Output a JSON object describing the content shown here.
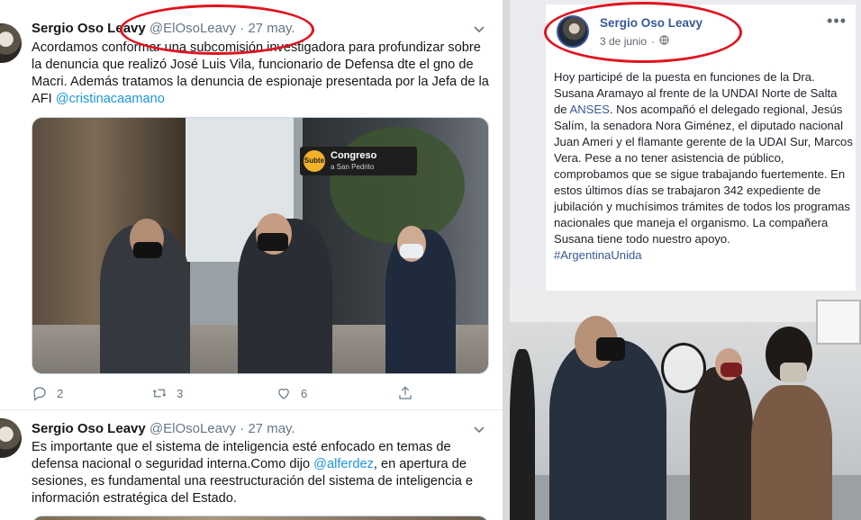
{
  "twitter": {
    "tweets": [
      {
        "name": "Sergio Oso Leavy",
        "handle": "@ElOsoLeavy",
        "dot": "·",
        "date": "27 may.",
        "text_before": "Acordamos conformar una subcomisión investigadora para profundizar sobre la denuncia  que realizó José Luis Vila, funcionario de Defensa dte el gno de Macri. Además tratamos la denuncia de espionaje presentada por la Jefa de la AFI ",
        "mention": "@cristinacaamano",
        "text_after": "",
        "photo": {
          "sign_title": "Congreso",
          "sign_sub": "a San Pedrito",
          "subte": "Subte"
        },
        "replies": "2",
        "retweets": "3",
        "likes": "6"
      },
      {
        "name": "Sergio Oso Leavy",
        "handle": "@ElOsoLeavy",
        "dot": "·",
        "date": "27 may.",
        "text_before": "Es importante que el sistema de inteligencia esté enfocado en temas de defensa nacional o seguridad interna.Como dijo ",
        "mention": "@alferdez",
        "text_after": ", en apertura de sesiones, es fundamental una  reestructuración del sistema de inteligencia e información estratégica del Estado."
      }
    ]
  },
  "facebook": {
    "name": "Sergio Oso Leavy",
    "date": "3 de junio",
    "dot": "·",
    "more": "•••",
    "text_before": "Hoy participé de la puesta en funciones de la Dra. Susana Aramayo al frente de la UNDAI Norte de Salta de ",
    "link1": "ANSES",
    "text_after": ". Nos acompañó el delegado regional, Jesús Salím, la senadora Nora Giménez, el diputado nacional Juan Ameri y el flamante gerente de la UDAI Sur, Marcos Vera. Pese a no tener asistencia de público, comprobamos que se sigue trabajando fuertemente. En estos últimos días se trabajaron 342 expediente de jubilación y muchísimos trámites de todos los programas nacionales que maneja el organismo. La compañera Susana tiene todo nuestro apoyo.",
    "hashtag": "#ArgentinaUnida"
  },
  "colors": {
    "twitter_link": "#1b95e0",
    "facebook_link": "#385898",
    "annotation_ring": "#e0141e"
  }
}
